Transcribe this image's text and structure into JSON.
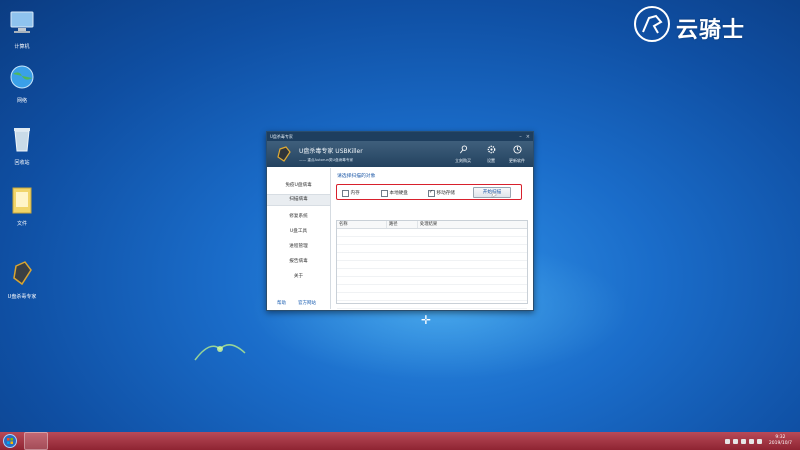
{
  "desktop": {
    "icons": [
      {
        "label": "计算机",
        "icon": "computer-icon"
      },
      {
        "label": "网络",
        "icon": "network-icon"
      },
      {
        "label": "回收站",
        "icon": "recycle-bin-icon"
      },
      {
        "label": "文件",
        "icon": "folder-icon"
      },
      {
        "label": "U盘杀毒专家",
        "icon": "usbkiller-icon"
      }
    ],
    "watermark": "云骑士"
  },
  "window": {
    "title": "U盘杀毒专家",
    "app_name": "U盘杀毒专家   USBKiller",
    "app_sub": "—— 重点Autorun类U盘病毒专家",
    "header_buttons": [
      {
        "label": "立刻购买",
        "icon": "key-icon"
      },
      {
        "label": "设置",
        "icon": "gear-icon"
      },
      {
        "label": "更新软件",
        "icon": "refresh-icon"
      }
    ],
    "sidebar": {
      "items": [
        "免疫U盘病毒",
        "扫描病毒",
        "修复系统",
        "U盘工具",
        "进程管理",
        "报告病毒",
        "关于"
      ],
      "active_index": 1,
      "help": "帮助",
      "official_site": "官方网站"
    },
    "scan": {
      "prompt": "请选择扫描的对象",
      "options": [
        {
          "label": "内存",
          "checked": false
        },
        {
          "label": "本地硬盘",
          "checked": false
        },
        {
          "label": "移动存储",
          "checked": true
        }
      ],
      "start_button": "开始扫描"
    },
    "results_table": {
      "columns": [
        "名称",
        "路径",
        "处理结果"
      ],
      "rows": []
    }
  },
  "taskbar": {
    "clock_time": "9:32",
    "clock_date": "2019/10/7"
  }
}
